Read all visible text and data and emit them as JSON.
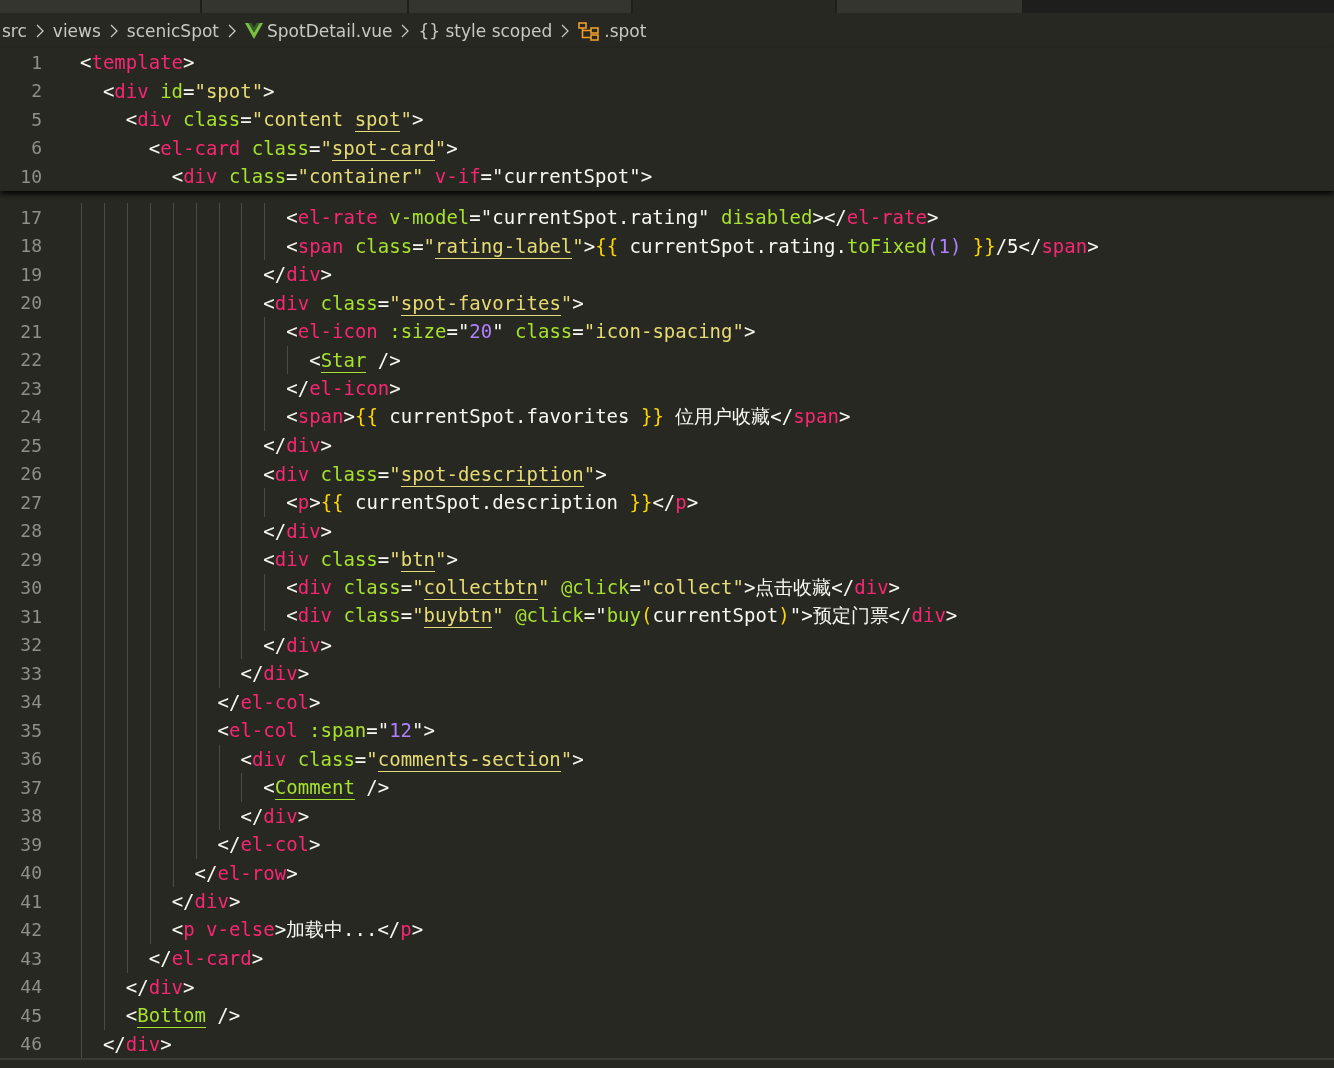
{
  "tabs": [
    {
      "selected": false
    },
    {
      "selected": false
    },
    {
      "selected": false
    },
    {
      "selected": true
    },
    {
      "selected": false
    }
  ],
  "breadcrumb": [
    {
      "kind": "folder",
      "label": "src"
    },
    {
      "kind": "folder",
      "label": "views"
    },
    {
      "kind": "folder",
      "label": "scenicSpot"
    },
    {
      "kind": "vue",
      "label": "SpotDetail.vue"
    },
    {
      "kind": "block",
      "label": "{} style scoped"
    },
    {
      "kind": "class",
      "label": ".spot"
    }
  ],
  "sticky_lines": [
    {
      "number": "1",
      "tokens": [
        {
          "kind": "punct",
          "text": "<"
        },
        {
          "kind": "tag",
          "text": "template"
        },
        {
          "kind": "punct",
          "text": ">"
        }
      ]
    },
    {
      "number": "2",
      "tokens": [
        {
          "kind": "punct",
          "text": "  <"
        },
        {
          "kind": "tag",
          "text": "div"
        },
        {
          "kind": "attr",
          "text": " id"
        },
        {
          "kind": "punct",
          "text": "="
        },
        {
          "kind": "str",
          "text": "\"spot\""
        },
        {
          "kind": "punct",
          "text": ">"
        }
      ]
    },
    {
      "number": "5",
      "tokens": [
        {
          "kind": "punct",
          "text": "    <"
        },
        {
          "kind": "tag",
          "text": "div"
        },
        {
          "kind": "attr",
          "text": " class"
        },
        {
          "kind": "punct",
          "text": "="
        },
        {
          "kind": "str",
          "text": "\"content "
        },
        {
          "kind": "ref",
          "text": "spot"
        },
        {
          "kind": "str",
          "text": "\""
        },
        {
          "kind": "punct",
          "text": ">"
        }
      ]
    },
    {
      "number": "6",
      "tokens": [
        {
          "kind": "punct",
          "text": "      <"
        },
        {
          "kind": "tag",
          "text": "el-card"
        },
        {
          "kind": "attr",
          "text": " class"
        },
        {
          "kind": "punct",
          "text": "="
        },
        {
          "kind": "str",
          "text": "\""
        },
        {
          "kind": "ref",
          "text": "spot-card"
        },
        {
          "kind": "str",
          "text": "\""
        },
        {
          "kind": "punct",
          "text": ">"
        }
      ]
    },
    {
      "number": "10",
      "tokens": [
        {
          "kind": "punct",
          "text": "        <"
        },
        {
          "kind": "tag",
          "text": "div"
        },
        {
          "kind": "attr",
          "text": " class"
        },
        {
          "kind": "punct",
          "text": "="
        },
        {
          "kind": "str",
          "text": "\"container\""
        },
        {
          "kind": "tag",
          "text": " v-if"
        },
        {
          "kind": "punct",
          "text": "=\"currentSpot\">"
        }
      ]
    }
  ],
  "lines": [
    {
      "number": "17",
      "tokens": [
        {
          "kind": "punct",
          "text": "                  <"
        },
        {
          "kind": "tag",
          "text": "el-rate"
        },
        {
          "kind": "attr",
          "text": " v-model"
        },
        {
          "kind": "punct",
          "text": "=\"currentSpot.rating\""
        },
        {
          "kind": "attr",
          "text": " disabled"
        },
        {
          "kind": "punct",
          "text": "></"
        },
        {
          "kind": "tag",
          "text": "el-rate"
        },
        {
          "kind": "punct",
          "text": ">"
        }
      ]
    },
    {
      "number": "18",
      "tokens": [
        {
          "kind": "punct",
          "text": "                  <"
        },
        {
          "kind": "tag",
          "text": "span"
        },
        {
          "kind": "attr",
          "text": " class"
        },
        {
          "kind": "punct",
          "text": "="
        },
        {
          "kind": "str",
          "text": "\""
        },
        {
          "kind": "ref",
          "text": "rating-label"
        },
        {
          "kind": "str",
          "text": "\""
        },
        {
          "kind": "punct",
          "text": ">"
        },
        {
          "kind": "brace",
          "text": "{{"
        },
        {
          "kind": "punct",
          "text": " currentSpot.rating."
        },
        {
          "kind": "fn",
          "text": "toFixed"
        },
        {
          "kind": "paren",
          "text": "("
        },
        {
          "kind": "num",
          "text": "1"
        },
        {
          "kind": "paren",
          "text": ")"
        },
        {
          "kind": "brace",
          "text": " }}"
        },
        {
          "kind": "punct",
          "text": "/5</"
        },
        {
          "kind": "tag",
          "text": "span"
        },
        {
          "kind": "punct",
          "text": ">"
        }
      ]
    },
    {
      "number": "19",
      "tokens": [
        {
          "kind": "punct",
          "text": "                </"
        },
        {
          "kind": "tag",
          "text": "div"
        },
        {
          "kind": "punct",
          "text": ">"
        }
      ]
    },
    {
      "number": "20",
      "tokens": [
        {
          "kind": "punct",
          "text": "                <"
        },
        {
          "kind": "tag",
          "text": "div"
        },
        {
          "kind": "attr",
          "text": " class"
        },
        {
          "kind": "punct",
          "text": "="
        },
        {
          "kind": "str",
          "text": "\""
        },
        {
          "kind": "ref",
          "text": "spot-favorites"
        },
        {
          "kind": "str",
          "text": "\""
        },
        {
          "kind": "punct",
          "text": ">"
        }
      ]
    },
    {
      "number": "21",
      "tokens": [
        {
          "kind": "punct",
          "text": "                  <"
        },
        {
          "kind": "tag",
          "text": "el-icon"
        },
        {
          "kind": "attr",
          "text": " :size"
        },
        {
          "kind": "punct",
          "text": "=\""
        },
        {
          "kind": "num",
          "text": "20"
        },
        {
          "kind": "punct",
          "text": "\""
        },
        {
          "kind": "attr",
          "text": " class"
        },
        {
          "kind": "punct",
          "text": "="
        },
        {
          "kind": "str",
          "text": "\"icon-spacing\""
        },
        {
          "kind": "punct",
          "text": ">"
        }
      ]
    },
    {
      "number": "22",
      "tokens": [
        {
          "kind": "punct",
          "text": "                    <"
        },
        {
          "kind": "comp",
          "text": "Star"
        },
        {
          "kind": "punct",
          "text": " />"
        }
      ]
    },
    {
      "number": "23",
      "tokens": [
        {
          "kind": "punct",
          "text": "                  </"
        },
        {
          "kind": "tag",
          "text": "el-icon"
        },
        {
          "kind": "punct",
          "text": ">"
        }
      ]
    },
    {
      "number": "24",
      "tokens": [
        {
          "kind": "punct",
          "text": "                  <"
        },
        {
          "kind": "tag",
          "text": "span"
        },
        {
          "kind": "punct",
          "text": ">"
        },
        {
          "kind": "brace",
          "text": "{{"
        },
        {
          "kind": "punct",
          "text": " currentSpot.favorites "
        },
        {
          "kind": "brace",
          "text": "}}"
        },
        {
          "kind": "punct",
          "text": " 位用户收藏</"
        },
        {
          "kind": "tag",
          "text": "span"
        },
        {
          "kind": "punct",
          "text": ">"
        }
      ]
    },
    {
      "number": "25",
      "tokens": [
        {
          "kind": "punct",
          "text": "                </"
        },
        {
          "kind": "tag",
          "text": "div"
        },
        {
          "kind": "punct",
          "text": ">"
        }
      ]
    },
    {
      "number": "26",
      "tokens": [
        {
          "kind": "punct",
          "text": "                <"
        },
        {
          "kind": "tag",
          "text": "div"
        },
        {
          "kind": "attr",
          "text": " class"
        },
        {
          "kind": "punct",
          "text": "="
        },
        {
          "kind": "str",
          "text": "\""
        },
        {
          "kind": "ref",
          "text": "spot-description"
        },
        {
          "kind": "str",
          "text": "\""
        },
        {
          "kind": "punct",
          "text": ">"
        }
      ]
    },
    {
      "number": "27",
      "tokens": [
        {
          "kind": "punct",
          "text": "                  <"
        },
        {
          "kind": "tag",
          "text": "p"
        },
        {
          "kind": "punct",
          "text": ">"
        },
        {
          "kind": "brace",
          "text": "{{"
        },
        {
          "kind": "punct",
          "text": " currentSpot.description "
        },
        {
          "kind": "brace",
          "text": "}}"
        },
        {
          "kind": "punct",
          "text": "</"
        },
        {
          "kind": "tag",
          "text": "p"
        },
        {
          "kind": "punct",
          "text": ">"
        }
      ]
    },
    {
      "number": "28",
      "tokens": [
        {
          "kind": "punct",
          "text": "                </"
        },
        {
          "kind": "tag",
          "text": "div"
        },
        {
          "kind": "punct",
          "text": ">"
        }
      ]
    },
    {
      "number": "29",
      "tokens": [
        {
          "kind": "punct",
          "text": "                <"
        },
        {
          "kind": "tag",
          "text": "div"
        },
        {
          "kind": "attr",
          "text": " class"
        },
        {
          "kind": "punct",
          "text": "="
        },
        {
          "kind": "str",
          "text": "\""
        },
        {
          "kind": "ref",
          "text": "btn"
        },
        {
          "kind": "str",
          "text": "\""
        },
        {
          "kind": "punct",
          "text": ">"
        }
      ]
    },
    {
      "number": "30",
      "tokens": [
        {
          "kind": "punct",
          "text": "                  <"
        },
        {
          "kind": "tag",
          "text": "div"
        },
        {
          "kind": "attr",
          "text": " class"
        },
        {
          "kind": "punct",
          "text": "="
        },
        {
          "kind": "str",
          "text": "\""
        },
        {
          "kind": "ref",
          "text": "collectbtn"
        },
        {
          "kind": "str",
          "text": "\""
        },
        {
          "kind": "attr",
          "text": " @click"
        },
        {
          "kind": "punct",
          "text": "="
        },
        {
          "kind": "str",
          "text": "\"collect\""
        },
        {
          "kind": "punct",
          "text": ">点击收藏</"
        },
        {
          "kind": "tag",
          "text": "div"
        },
        {
          "kind": "punct",
          "text": ">"
        }
      ]
    },
    {
      "number": "31",
      "tokens": [
        {
          "kind": "punct",
          "text": "                  <"
        },
        {
          "kind": "tag",
          "text": "div"
        },
        {
          "kind": "attr",
          "text": " class"
        },
        {
          "kind": "punct",
          "text": "="
        },
        {
          "kind": "str",
          "text": "\""
        },
        {
          "kind": "ref",
          "text": "buybtn"
        },
        {
          "kind": "str",
          "text": "\""
        },
        {
          "kind": "attr",
          "text": " @click"
        },
        {
          "kind": "punct",
          "text": "=\""
        },
        {
          "kind": "fn",
          "text": "buy"
        },
        {
          "kind": "brace",
          "text": "("
        },
        {
          "kind": "punct",
          "text": "currentSpot"
        },
        {
          "kind": "brace",
          "text": ")"
        },
        {
          "kind": "punct",
          "text": "\">预定门票</"
        },
        {
          "kind": "tag",
          "text": "div"
        },
        {
          "kind": "punct",
          "text": ">"
        }
      ]
    },
    {
      "number": "32",
      "tokens": [
        {
          "kind": "punct",
          "text": "                </"
        },
        {
          "kind": "tag",
          "text": "div"
        },
        {
          "kind": "punct",
          "text": ">"
        }
      ]
    },
    {
      "number": "33",
      "tokens": [
        {
          "kind": "punct",
          "text": "              </"
        },
        {
          "kind": "tag",
          "text": "div"
        },
        {
          "kind": "punct",
          "text": ">"
        }
      ]
    },
    {
      "number": "34",
      "tokens": [
        {
          "kind": "punct",
          "text": "            </"
        },
        {
          "kind": "tag",
          "text": "el-col"
        },
        {
          "kind": "punct",
          "text": ">"
        }
      ]
    },
    {
      "number": "35",
      "tokens": [
        {
          "kind": "punct",
          "text": "            <"
        },
        {
          "kind": "tag",
          "text": "el-col"
        },
        {
          "kind": "attr",
          "text": " :span"
        },
        {
          "kind": "punct",
          "text": "=\""
        },
        {
          "kind": "num",
          "text": "12"
        },
        {
          "kind": "punct",
          "text": "\">"
        }
      ]
    },
    {
      "number": "36",
      "tokens": [
        {
          "kind": "punct",
          "text": "              <"
        },
        {
          "kind": "tag",
          "text": "div"
        },
        {
          "kind": "attr",
          "text": " class"
        },
        {
          "kind": "punct",
          "text": "="
        },
        {
          "kind": "str",
          "text": "\""
        },
        {
          "kind": "ref",
          "text": "comments-section"
        },
        {
          "kind": "str",
          "text": "\""
        },
        {
          "kind": "punct",
          "text": ">"
        }
      ]
    },
    {
      "number": "37",
      "tokens": [
        {
          "kind": "punct",
          "text": "                <"
        },
        {
          "kind": "comp",
          "text": "Comment"
        },
        {
          "kind": "punct",
          "text": " />"
        }
      ]
    },
    {
      "number": "38",
      "tokens": [
        {
          "kind": "punct",
          "text": "              </"
        },
        {
          "kind": "tag",
          "text": "div"
        },
        {
          "kind": "punct",
          "text": ">"
        }
      ]
    },
    {
      "number": "39",
      "tokens": [
        {
          "kind": "punct",
          "text": "            </"
        },
        {
          "kind": "tag",
          "text": "el-col"
        },
        {
          "kind": "punct",
          "text": ">"
        }
      ]
    },
    {
      "number": "40",
      "tokens": [
        {
          "kind": "punct",
          "text": "          </"
        },
        {
          "kind": "tag",
          "text": "el-row"
        },
        {
          "kind": "punct",
          "text": ">"
        }
      ]
    },
    {
      "number": "41",
      "tokens": [
        {
          "kind": "punct",
          "text": "        </"
        },
        {
          "kind": "tag",
          "text": "div"
        },
        {
          "kind": "punct",
          "text": ">"
        }
      ]
    },
    {
      "number": "42",
      "tokens": [
        {
          "kind": "punct",
          "text": "        <"
        },
        {
          "kind": "tag",
          "text": "p"
        },
        {
          "kind": "tag",
          "text": " v-else"
        },
        {
          "kind": "punct",
          "text": ">加载中...</"
        },
        {
          "kind": "tag",
          "text": "p"
        },
        {
          "kind": "punct",
          "text": ">"
        }
      ]
    },
    {
      "number": "43",
      "tokens": [
        {
          "kind": "punct",
          "text": "      </"
        },
        {
          "kind": "tag",
          "text": "el-card"
        },
        {
          "kind": "punct",
          "text": ">"
        }
      ]
    },
    {
      "number": "44",
      "tokens": [
        {
          "kind": "punct",
          "text": "    </"
        },
        {
          "kind": "tag",
          "text": "div"
        },
        {
          "kind": "punct",
          "text": ">"
        }
      ]
    },
    {
      "number": "45",
      "tokens": [
        {
          "kind": "punct",
          "text": "    <"
        },
        {
          "kind": "comp",
          "text": "Bottom"
        },
        {
          "kind": "punct",
          "text": " />"
        }
      ]
    },
    {
      "number": "46",
      "tokens": [
        {
          "kind": "punct",
          "text": "  </"
        },
        {
          "kind": "tag",
          "text": "div"
        },
        {
          "kind": "punct",
          "text": ">"
        }
      ]
    }
  ]
}
